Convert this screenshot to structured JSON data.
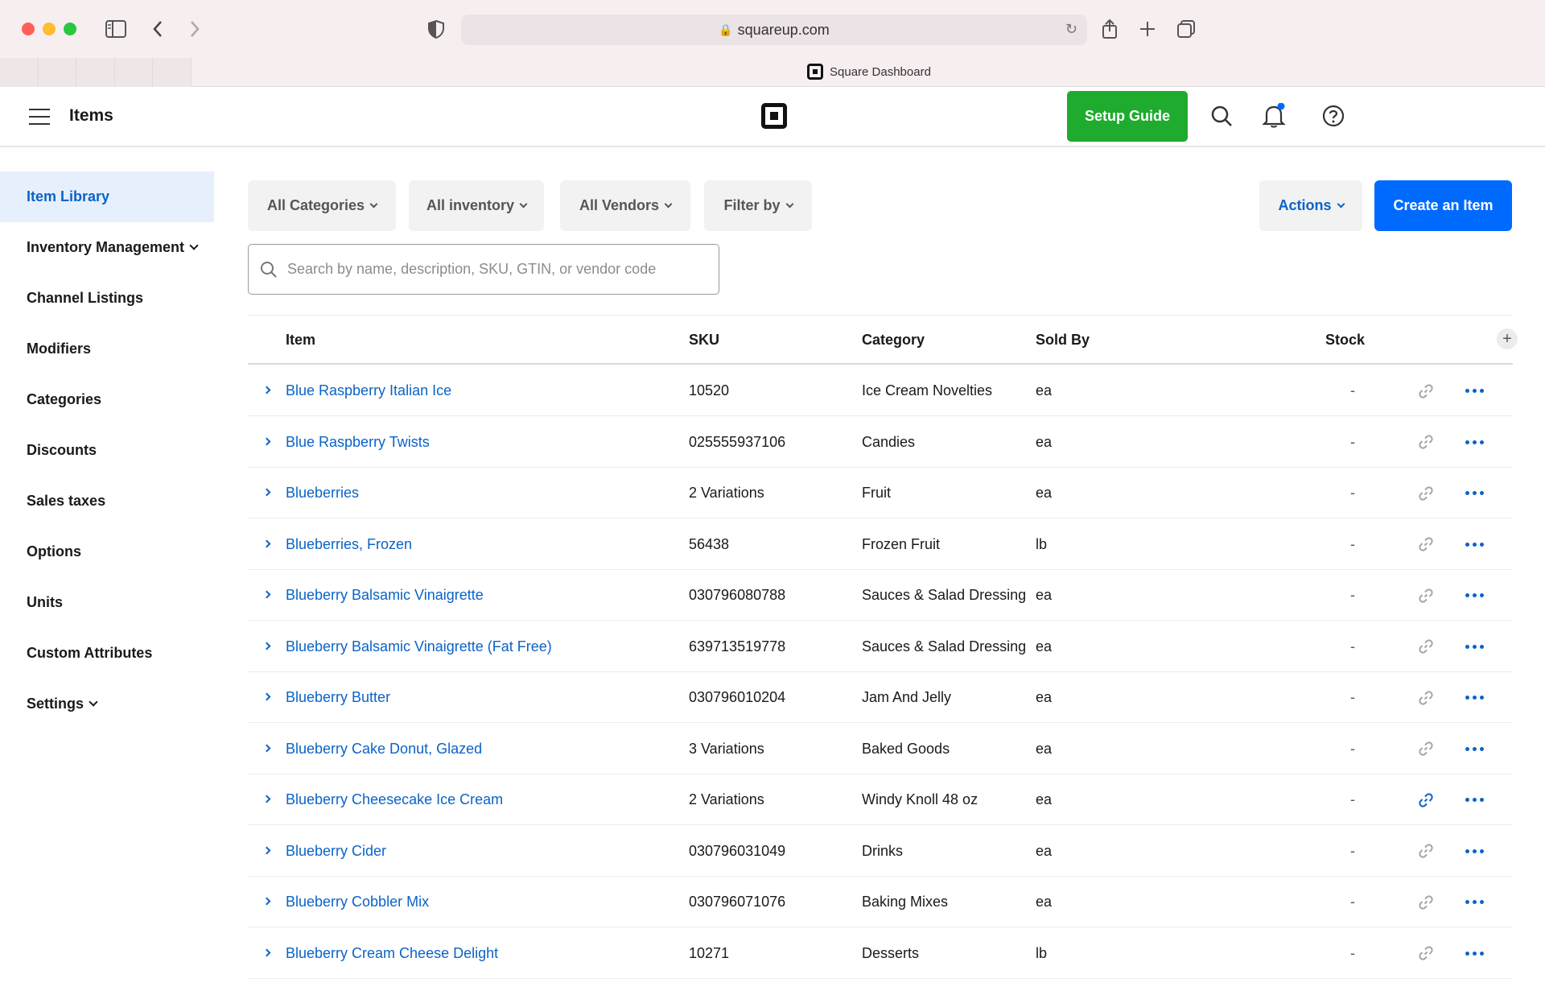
{
  "browser": {
    "url": "squareup.com",
    "tab_title": "Square Dashboard"
  },
  "header": {
    "title": "Items",
    "setup_guide": "Setup Guide"
  },
  "sidebar": {
    "items": [
      {
        "label": "Item Library"
      },
      {
        "label": "Inventory Management"
      },
      {
        "label": "Channel Listings"
      },
      {
        "label": "Modifiers"
      },
      {
        "label": "Categories"
      },
      {
        "label": "Discounts"
      },
      {
        "label": "Sales taxes"
      },
      {
        "label": "Options"
      },
      {
        "label": "Units"
      },
      {
        "label": "Custom Attributes"
      },
      {
        "label": "Settings"
      }
    ]
  },
  "filters": {
    "categories": "All Categories",
    "inventory": "All inventory",
    "vendors": "All Vendors",
    "filter_by": "Filter by",
    "actions": "Actions",
    "create": "Create an Item"
  },
  "search": {
    "placeholder": "Search by name, description, SKU, GTIN, or vendor code"
  },
  "table": {
    "columns": {
      "item": "Item",
      "sku": "SKU",
      "category": "Category",
      "sold_by": "Sold By",
      "stock": "Stock"
    },
    "rows": [
      {
        "name": "Blue Raspberry Italian Ice",
        "sku": "10520",
        "category": "Ice Cream Novelties",
        "sold_by": "ea",
        "stock": "-"
      },
      {
        "name": "Blue Raspberry Twists",
        "sku": "025555937106",
        "category": "Candies",
        "sold_by": "ea",
        "stock": "-"
      },
      {
        "name": "Blueberries",
        "sku": "2 Variations",
        "category": "Fruit",
        "sold_by": "ea",
        "stock": "-"
      },
      {
        "name": "Blueberries, Frozen",
        "sku": "56438",
        "category": "Frozen Fruit",
        "sold_by": "lb",
        "stock": "-"
      },
      {
        "name": "Blueberry Balsamic Vinaigrette",
        "sku": "030796080788",
        "category": "Sauces & Salad Dressing",
        "sold_by": "ea",
        "stock": "-"
      },
      {
        "name": "Blueberry Balsamic Vinaigrette (Fat Free)",
        "sku": "639713519778",
        "category": "Sauces & Salad Dressing",
        "sold_by": "ea",
        "stock": "-"
      },
      {
        "name": "Blueberry Butter",
        "sku": "030796010204",
        "category": "Jam And Jelly",
        "sold_by": "ea",
        "stock": "-"
      },
      {
        "name": "Blueberry Cake Donut, Glazed",
        "sku": "3 Variations",
        "category": "Baked Goods",
        "sold_by": "ea",
        "stock": "-"
      },
      {
        "name": "Blueberry Cheesecake Ice Cream",
        "sku": "2 Variations",
        "category": "Windy Knoll 48 oz",
        "sold_by": "ea",
        "stock": "-",
        "linked": true
      },
      {
        "name": "Blueberry Cider",
        "sku": "030796031049",
        "category": "Drinks",
        "sold_by": "ea",
        "stock": "-"
      },
      {
        "name": "Blueberry Cobbler Mix",
        "sku": "030796071076",
        "category": "Baking Mixes",
        "sold_by": "ea",
        "stock": "-"
      },
      {
        "name": "Blueberry Cream Cheese Delight",
        "sku": "10271",
        "category": "Desserts",
        "sold_by": "lb",
        "stock": "-"
      }
    ]
  },
  "colors": {
    "accent": "#0a63c8",
    "primary_button": "#006aff",
    "setup_guide": "#1fab2e",
    "link_inactive": "#a6a6a6"
  }
}
